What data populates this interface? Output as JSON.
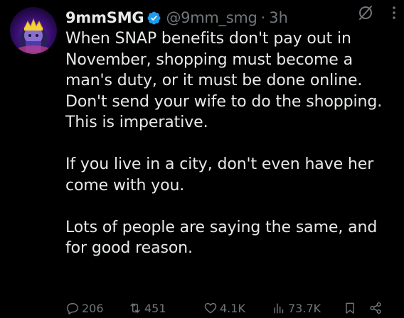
{
  "tweet": {
    "display_name": "9mmSMG",
    "handle": "@9mm_smg",
    "separator": "·",
    "time": "3h",
    "verified": true,
    "avatar_icon": "crowned-figure-avatar",
    "paragraphs": [
      "When SNAP benefits don't pay out in November, shopping must become a man's duty, or it must be done online. Don't send your wife to do the shopping. This is imperative.",
      "If you live in a city, don't even have her come with you.",
      "Lots of people are saying the same, and for good reason."
    ],
    "stats": {
      "replies": "206",
      "reposts": "451",
      "likes": "4.1K",
      "views": "73.7K"
    }
  },
  "colors": {
    "background": "#000000",
    "text": "#e7e9ea",
    "secondary": "#71767b",
    "verified": "#1d9bf0"
  },
  "icons": {
    "verified": "verified-badge-icon",
    "grok": "grok-icon",
    "more": "more-options-icon",
    "reply": "reply-icon",
    "repost": "repost-icon",
    "like": "heart-icon",
    "views": "views-chart-icon",
    "bookmark": "bookmark-icon",
    "share": "share-icon"
  }
}
